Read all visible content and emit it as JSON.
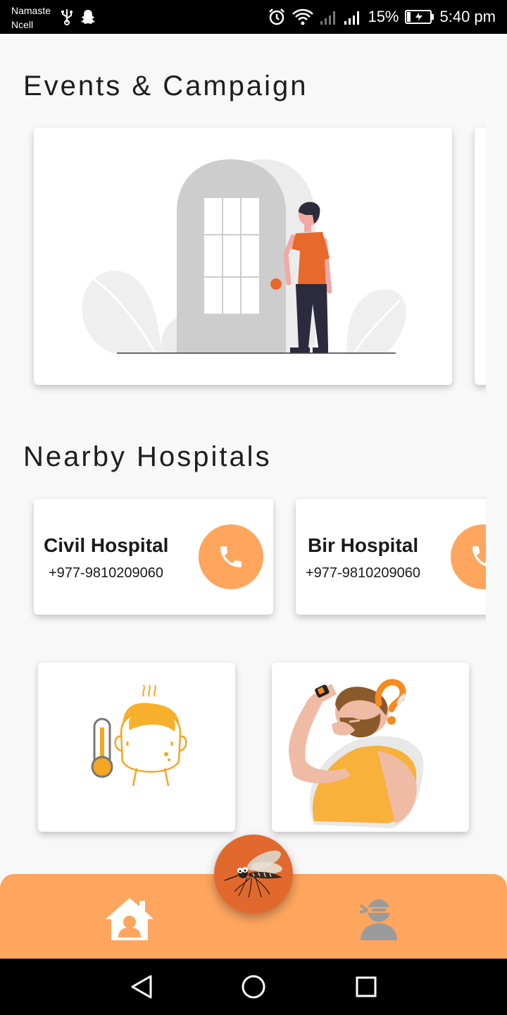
{
  "status_bar": {
    "carrier_line1": "Namaste",
    "carrier_line2": "Ncell",
    "battery_percent": "15%",
    "time": "5:40 pm"
  },
  "events": {
    "title": "Events & Campaign"
  },
  "hospitals": {
    "title": "Nearby Hospitals",
    "items": [
      {
        "name": "Civil Hospital",
        "phone": "+977-9810209060"
      },
      {
        "name": "Bir Hospital",
        "phone": "+977-9810209060"
      }
    ]
  },
  "colors": {
    "accent": "#fea55e",
    "fab": "#e2692e",
    "background": "#f8f8f8"
  },
  "icons": {
    "call": "phone-icon",
    "fab": "mosquito-icon",
    "home": "home-user-icon",
    "profile": "ninja-user-icon"
  }
}
